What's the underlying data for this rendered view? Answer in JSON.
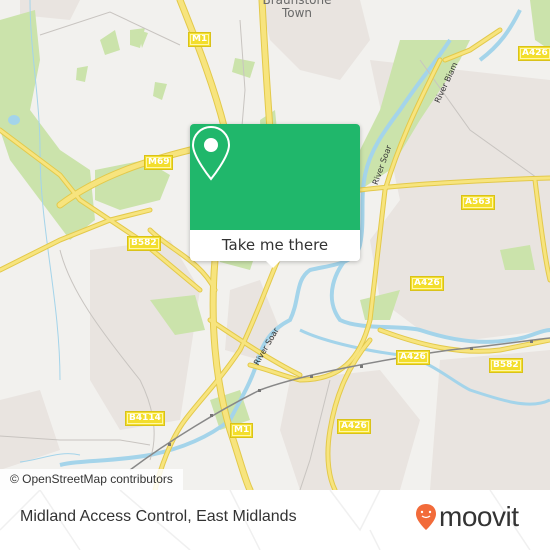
{
  "map": {
    "place_labels": [
      {
        "id": "braunstone-town",
        "text": "Braunstone Town"
      }
    ],
    "road_labels": [
      {
        "id": "m1-north",
        "text": "M1"
      },
      {
        "id": "m69",
        "text": "M69"
      },
      {
        "id": "b582-west",
        "text": "B582"
      },
      {
        "id": "a426-ne",
        "text": "A426"
      },
      {
        "id": "a563",
        "text": "A563"
      },
      {
        "id": "a426-mid",
        "text": "A426"
      },
      {
        "id": "a426-south-junction",
        "text": "A426"
      },
      {
        "id": "b582-east",
        "text": "B582"
      },
      {
        "id": "b4114",
        "text": "B4114"
      },
      {
        "id": "m1-south",
        "text": "M1"
      },
      {
        "id": "a426-south",
        "text": "A426"
      }
    ],
    "river_labels": [
      {
        "id": "river-soar-north",
        "text": "River Soar"
      },
      {
        "id": "river-biam",
        "text": "River Biam"
      },
      {
        "id": "river-soar-mid",
        "text": "River Soar"
      }
    ],
    "attribution": "© OpenStreetMap contributors",
    "colors": {
      "land": "#f2f1ee",
      "park": "#c8e0a6",
      "urban": "#e8e2de",
      "water": "#a4d4ea",
      "road_major": "#f5e073",
      "road_casing": "#e3c94a",
      "rail": "#777777"
    }
  },
  "popup": {
    "button_label": "Take me there",
    "icon": "map-pin-icon",
    "accent_color": "#20b76b"
  },
  "footer": {
    "place_title": "Midland Access Control, East Midlands",
    "brand": "moovit",
    "brand_color": "#f26b3a"
  }
}
